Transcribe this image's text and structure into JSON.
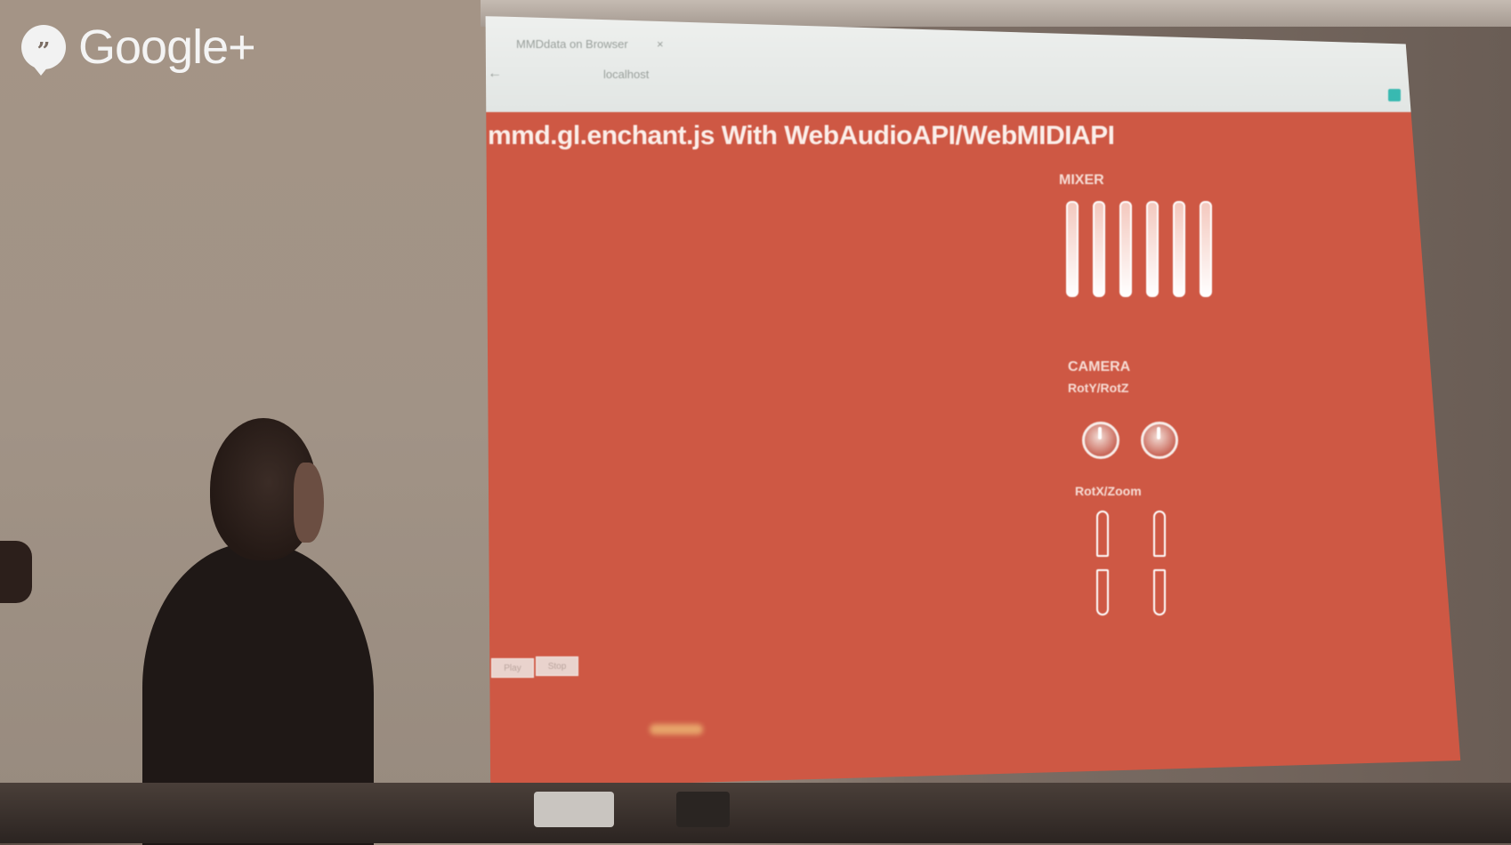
{
  "overlay": {
    "brand": "Google+",
    "brand_icon": "quote-bubble-icon"
  },
  "browser": {
    "tab_title": "MMDdata on Browser",
    "tab_close": "×",
    "back_icon": "←",
    "url": "localhost"
  },
  "page": {
    "title": "mmd.gl.enchant.js With WebAudioAPI/WebMIDIAPI",
    "background": "#ce5844",
    "mixer": {
      "label": "MIXER",
      "fader_count": 6
    },
    "camera": {
      "label": "CAMERA",
      "rot_label": "RotY/RotZ",
      "zoom_label": "RotX/Zoom"
    },
    "buttons": [
      "Play",
      "Stop"
    ]
  }
}
